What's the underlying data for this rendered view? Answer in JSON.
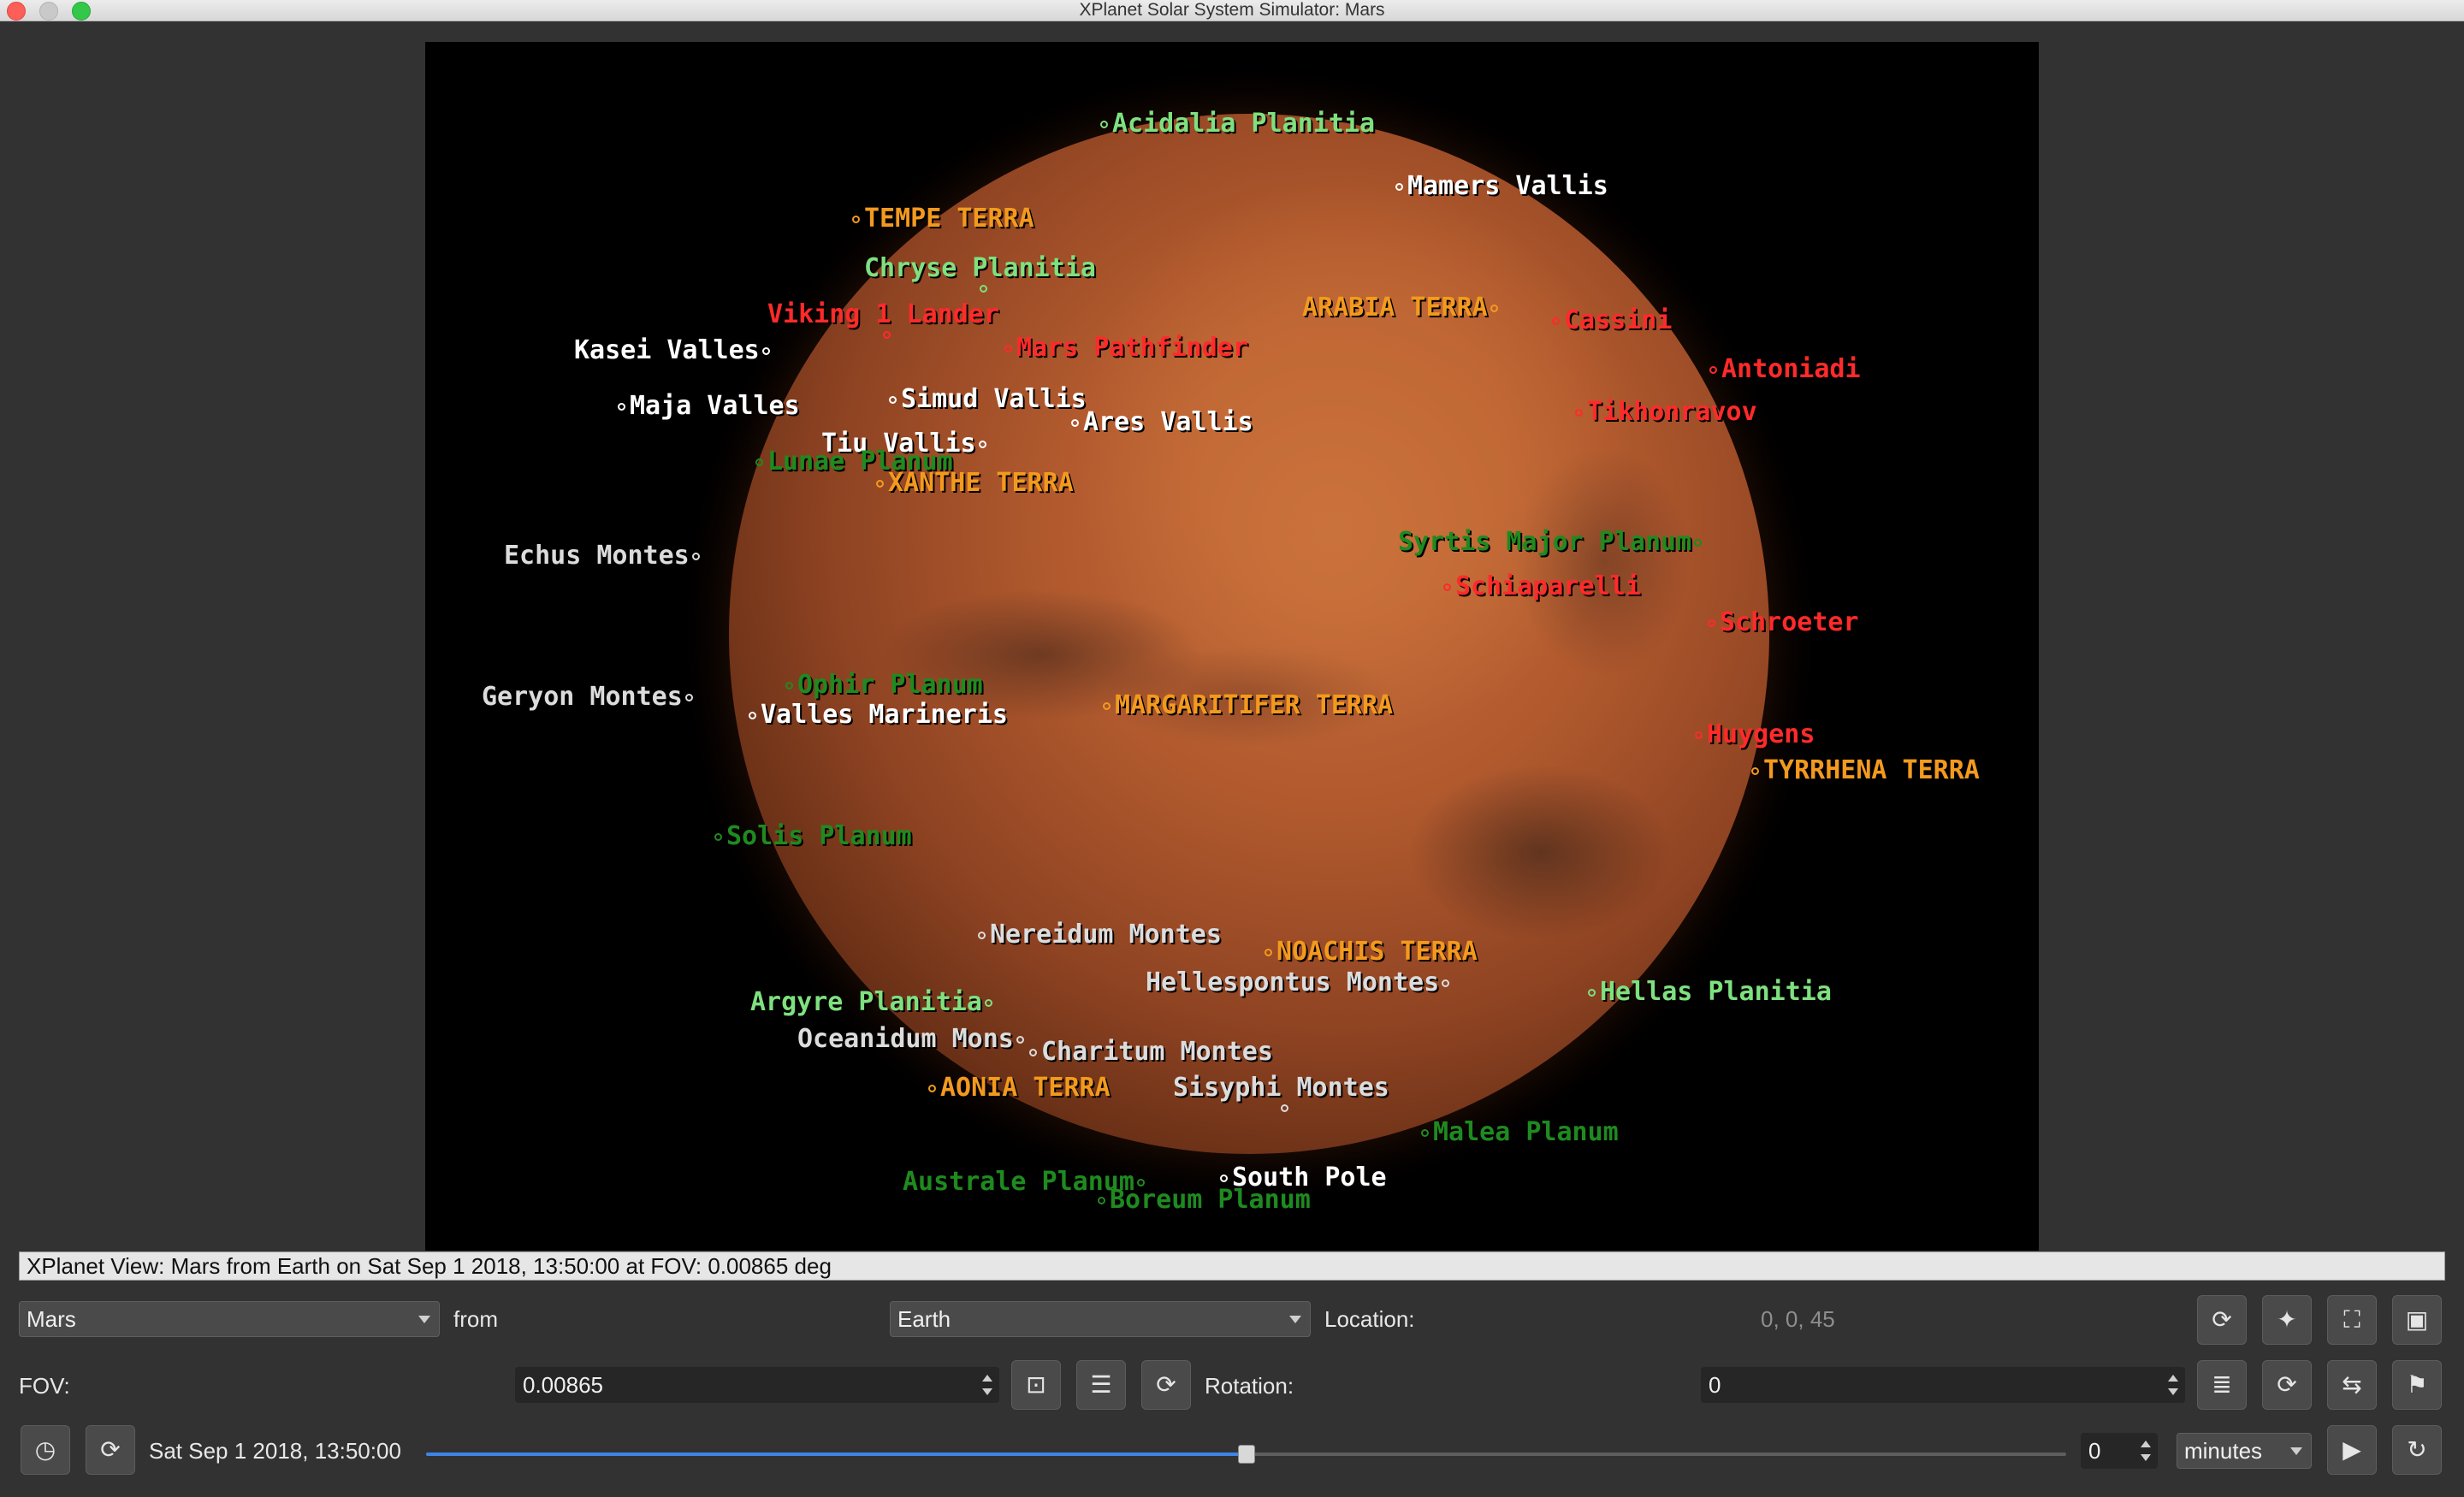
{
  "window": {
    "title": "XPlanet Solar System Simulator: Mars",
    "controls": [
      "close",
      "minimize",
      "zoom"
    ]
  },
  "map": {
    "labels": [
      {
        "text": "Acidalia Planitia",
        "color": "#7fe07f",
        "mx": 0
      },
      {
        "text": "Mamers Vallis",
        "color": "#ffffff",
        "mx": 0
      },
      {
        "text": "TEMPE TERRA",
        "color": "#f39a1e",
        "mx": 0
      },
      {
        "text": "Chryse Planitia",
        "color": "#7fe07f",
        "mx": -1
      },
      {
        "text": "Viking 1 Lander",
        "color": "#ff2a2a",
        "mx": -1
      },
      {
        "text": "ARABIA TERRA",
        "color": "#f39a1e",
        "mx": 1
      },
      {
        "text": "Cassini",
        "color": "#ff2a2a",
        "mx": 0
      },
      {
        "text": "Mars Pathfinder",
        "color": "#ff2a2a",
        "mx": 0
      },
      {
        "text": "Kasei Valles",
        "color": "#ffffff",
        "mx": 1
      },
      {
        "text": "Antoniadi",
        "color": "#ff2a2a",
        "mx": 0
      },
      {
        "text": "Simud Vallis",
        "color": "#ffffff",
        "mx": 0
      },
      {
        "text": "Maja Valles",
        "color": "#ffffff",
        "mx": 0
      },
      {
        "text": "Tikhonravov",
        "color": "#ff2a2a",
        "mx": 0
      },
      {
        "text": "Ares Vallis",
        "color": "#ffffff",
        "mx": 0
      },
      {
        "text": "Tiu Vallis",
        "color": "#ffffff",
        "mx": 1
      },
      {
        "text": "Lunae Planum",
        "color": "#1f8a1f",
        "mx": 0
      },
      {
        "text": "XANTHE TERRA",
        "color": "#f39a1e",
        "mx": 0
      },
      {
        "text": "Syrtis Major Planum",
        "color": "#1f8a1f",
        "mx": 1
      },
      {
        "text": "Echus Montes",
        "color": "#dcdcdc",
        "mx": 1
      },
      {
        "text": "Schiaparelli",
        "color": "#ff2a2a",
        "mx": 0
      },
      {
        "text": "Schroeter",
        "color": "#ff2a2a",
        "mx": 0
      },
      {
        "text": "Ophir Planum",
        "color": "#1f8a1f",
        "mx": 0
      },
      {
        "text": "Geryon Montes",
        "color": "#dcdcdc",
        "mx": 1
      },
      {
        "text": "Valles Marineris",
        "color": "#ffffff",
        "mx": 0
      },
      {
        "text": "MARGARITIFER TERRA",
        "color": "#f39a1e",
        "mx": 0
      },
      {
        "text": "Huygens",
        "color": "#ff2a2a",
        "mx": 0
      },
      {
        "text": "TYRRHENA TERRA",
        "color": "#f39a1e",
        "mx": 0
      },
      {
        "text": "Solis Planum",
        "color": "#1f8a1f",
        "mx": 0
      },
      {
        "text": "Nereidum Montes",
        "color": "#dcdcdc",
        "mx": 0
      },
      {
        "text": "NOACHIS TERRA",
        "color": "#f39a1e",
        "mx": 0
      },
      {
        "text": "Hellespontus Montes",
        "color": "#dcdcdc",
        "mx": 1
      },
      {
        "text": "Hellas Planitia",
        "color": "#7fe07f",
        "mx": 0
      },
      {
        "text": "Argyre Planitia",
        "color": "#7fe07f",
        "mx": 1
      },
      {
        "text": "Oceanidum Mons",
        "color": "#dcdcdc",
        "mx": 1
      },
      {
        "text": "Charitum Montes",
        "color": "#dcdcdc",
        "mx": 0
      },
      {
        "text": "AONIA TERRA",
        "color": "#f39a1e",
        "mx": 0
      },
      {
        "text": "Sisyphi Montes",
        "color": "#dcdcdc",
        "mx": -1
      },
      {
        "text": "Malea Planum",
        "color": "#1f8a1f",
        "mx": 0
      },
      {
        "text": "Australe Planum",
        "color": "#1f8a1f",
        "mx": 1
      },
      {
        "text": "South Pole",
        "color": "#ffffff",
        "mx": 0
      },
      {
        "text": "Boreum Planum",
        "color": "#1f8a1f",
        "mx": 0
      }
    ]
  },
  "status": {
    "text": "XPlanet View: Mars from Earth on Sat Sep 1 2018, 13:50:00 at FOV: 0.00865 deg"
  },
  "controls": {
    "target": "Mars",
    "from_label": "from",
    "origin": "Earth",
    "location_label": "Location:",
    "location_value": "0, 0, 45",
    "fov_label": "FOV:",
    "fov_value": "0.00865",
    "rotation_label": "Rotation:",
    "rotation_value": "0",
    "datetime": "Sat Sep 1 2018, 13:50:00",
    "time_position": 0.5,
    "step_value": "0",
    "step_unit": "minutes"
  },
  "icons": {
    "location_reset": "refresh-icon",
    "location_pick": "lighting-icon",
    "fit": "fit-icon",
    "save": "save-icon",
    "fov_fit": "fit-icon",
    "fov_list": "list-icon",
    "fov_reset": "refresh-icon",
    "rot_stack": "stack-icon",
    "rot_reset": "refresh-icon",
    "rot_adjust": "sliders-icon",
    "rot_flag": "flag-icon",
    "clock": "clock-icon",
    "time_reset": "refresh-icon",
    "play": "play-icon",
    "loop": "loop-icon"
  }
}
